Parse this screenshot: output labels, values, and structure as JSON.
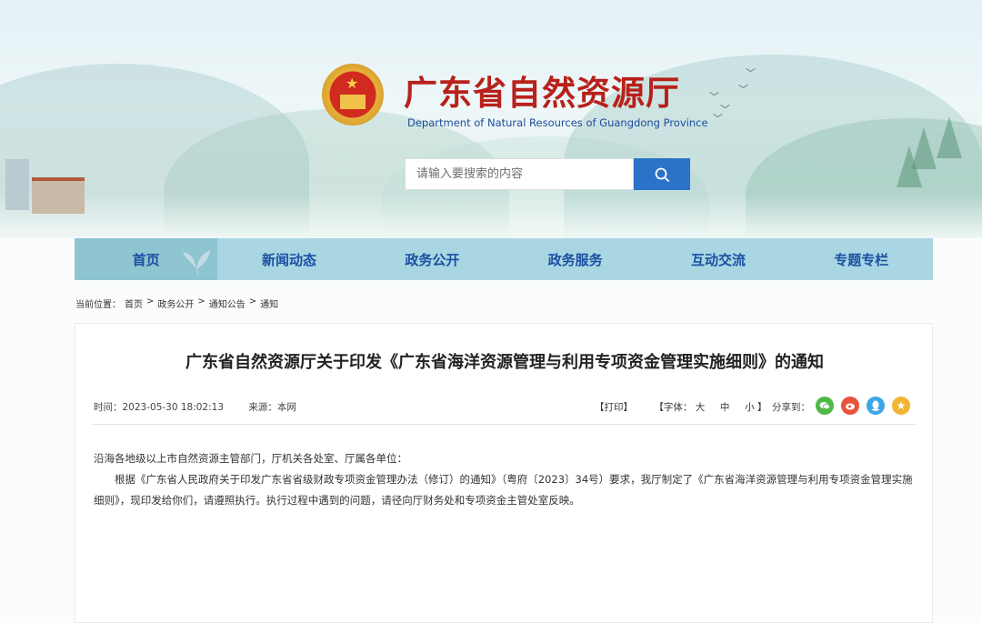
{
  "header": {
    "title_cn": "广东省自然资源厅",
    "title_en": "Department of Natural Resources of Guangdong Province"
  },
  "search": {
    "placeholder": "请输入要搜索的内容"
  },
  "nav": {
    "items": [
      "首页",
      "新闻动态",
      "政务公开",
      "政务服务",
      "互动交流",
      "专题专栏"
    ],
    "active": "首页"
  },
  "breadcrumb": {
    "prefix": "当前位置：",
    "items": [
      "首页",
      "政务公开",
      "通知公告",
      "通知"
    ],
    "sep": ">"
  },
  "article": {
    "title": "广东省自然资源厅关于印发《广东省海洋资源管理与利用专项资金管理实施细则》的通知",
    "time": "时间：2023-05-30 18:02:13",
    "source": "来源：本网",
    "print": "【打印】",
    "font_label": "【字体：",
    "font_large": "大",
    "font_medium": "中",
    "font_small": "小",
    "font_close": "】",
    "share_label": "分享到：",
    "share_icons": [
      "wechat-icon",
      "weibo-icon",
      "qq-icon",
      "qzone-icon"
    ],
    "paragraph1": "沿海各地级以上市自然资源主管部门，厅机关各处室、厅属各单位：",
    "paragraph2": "根据《广东省人民政府关于印发广东省省级财政专项资金管理办法（修订）的通知》（粤府〔2023〕34号）要求，我厅制定了《广东省海洋资源管理与利用专项资金管理实施细则》，现印发给你们，请遵照执行。执行过程中遇到的问题，请径向厅财务处和专项资金主管处室反映。"
  },
  "colors": {
    "title_red": "#b8211b",
    "nav_bg": "#a9d6e2",
    "nav_text": "#1a4fa3",
    "search_btn": "#2d72c9"
  }
}
